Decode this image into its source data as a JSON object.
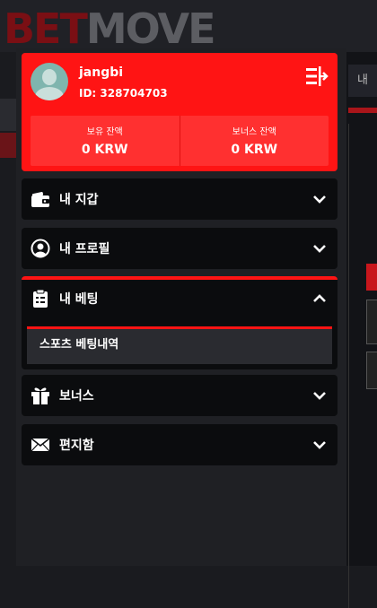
{
  "site": {
    "logo_part1": "BET",
    "logo_part2": "MOVE",
    "right_tab": "내 "
  },
  "profile": {
    "username": "jangbi",
    "user_id": "ID: 328704703",
    "balances": [
      {
        "label": "보유 잔액",
        "value": "0 KRW"
      },
      {
        "label": "보너스 잔액",
        "value": "0 KRW"
      }
    ]
  },
  "menu": {
    "wallet": {
      "label": "내 지갑",
      "icon": "wallet-icon"
    },
    "profile": {
      "label": "내 프로필",
      "icon": "user-circle-icon"
    },
    "betting": {
      "label": "내 베팅",
      "icon": "clipboard-icon",
      "expanded": true,
      "sub_items": [
        "스포츠 베팅내역"
      ]
    },
    "bonus": {
      "label": "보너스",
      "icon": "gift-icon"
    },
    "mailbox": {
      "label": "편지함",
      "icon": "envelope-icon"
    }
  },
  "colors": {
    "accent": "#ff1414",
    "panel": "#0b0c0e",
    "drawer": "#1f2024"
  }
}
